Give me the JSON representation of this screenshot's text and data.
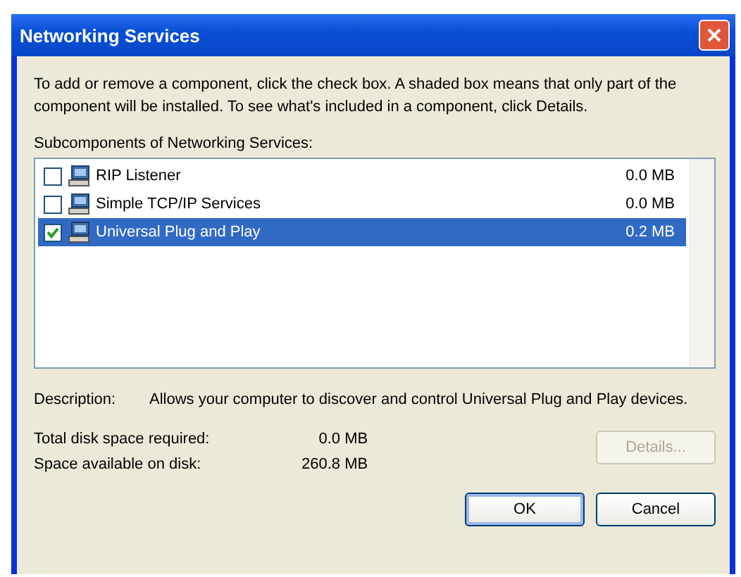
{
  "window": {
    "title": "Networking Services"
  },
  "intro": "To add or remove a component, click the check box. A shaded box means that only part of the component will be installed. To see what's included in a component, click Details.",
  "list_label": "Subcomponents of Networking Services:",
  "components": [
    {
      "name": "RIP Listener",
      "size": "0.0 MB",
      "checked": false,
      "selected": false
    },
    {
      "name": "Simple TCP/IP Services",
      "size": "0.0 MB",
      "checked": false,
      "selected": false
    },
    {
      "name": "Universal Plug and Play",
      "size": "0.2 MB",
      "checked": true,
      "selected": true
    }
  ],
  "description": {
    "label": "Description:",
    "text": "Allows your computer to discover and control Universal Plug and Play devices."
  },
  "disk": [
    {
      "label": "Total disk space required:",
      "value": "0.0 MB"
    },
    {
      "label": "Space available on disk:",
      "value": "260.8 MB"
    }
  ],
  "details_button": {
    "label": "Details...",
    "disabled": true
  },
  "buttons": [
    {
      "label": "OK",
      "default": true
    },
    {
      "label": "Cancel",
      "default": false
    }
  ]
}
